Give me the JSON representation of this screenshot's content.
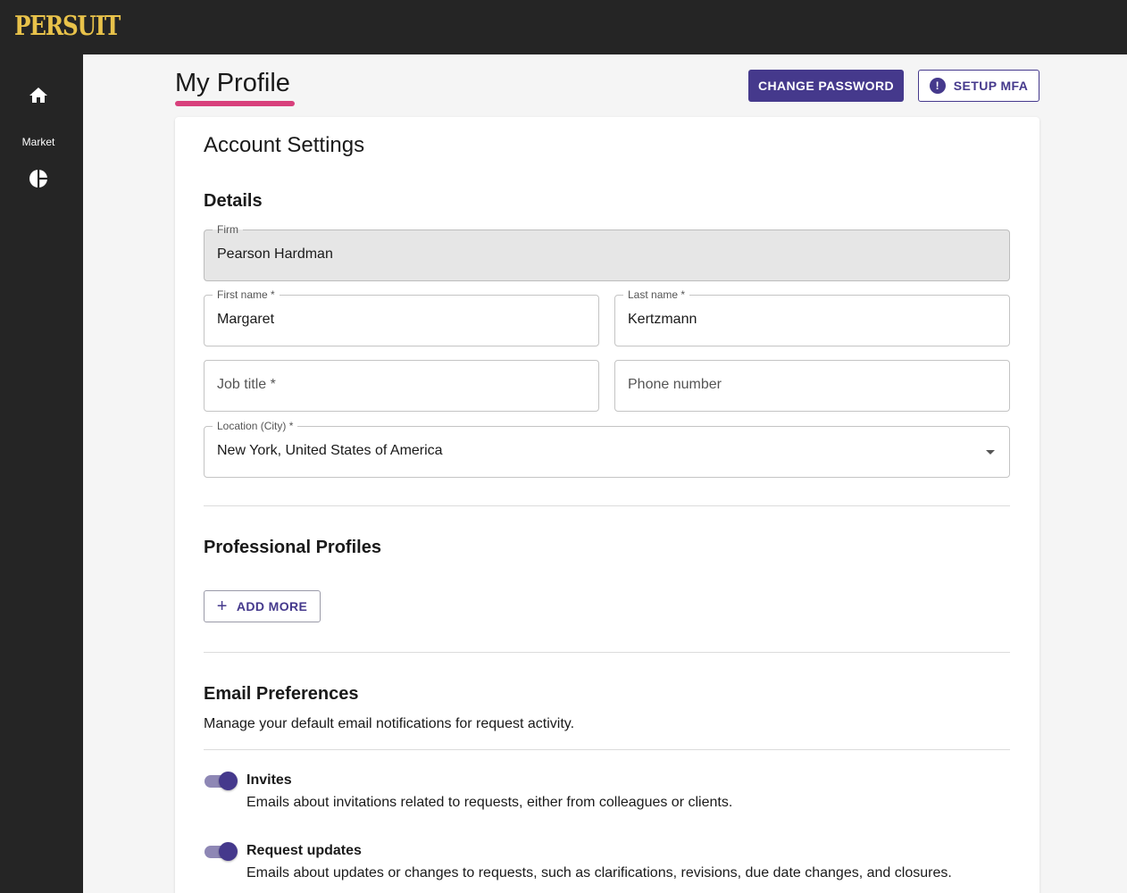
{
  "app": {
    "logo_text": "PERSUIT",
    "logo_color": "#e8c24a"
  },
  "sidebar": {
    "items": [
      {
        "icon": "home-icon",
        "label": ""
      },
      {
        "icon": "pie-chart-icon",
        "label": "Market"
      }
    ]
  },
  "header": {
    "title": "My Profile",
    "change_password_label": "CHANGE PASSWORD",
    "setup_mfa_label": "SETUP MFA",
    "setup_mfa_icon": "!"
  },
  "account": {
    "heading": "Account Settings",
    "details_heading": "Details",
    "fields": {
      "firm": {
        "label": "Firm",
        "value": "Pearson Hardman",
        "disabled": true
      },
      "first_name": {
        "label": "First name *",
        "value": "Margaret"
      },
      "last_name": {
        "label": "Last name *",
        "value": "Kertzmann"
      },
      "job_title": {
        "placeholder": "Job title *",
        "value": ""
      },
      "phone": {
        "placeholder": "Phone number",
        "value": ""
      },
      "location": {
        "label": "Location (City) *",
        "value": "New York, United States of America"
      }
    }
  },
  "professional_profiles": {
    "heading": "Professional Profiles",
    "add_more_label": "ADD MORE",
    "add_more_icon": "+"
  },
  "email_preferences": {
    "heading": "Email Preferences",
    "description": "Manage your default email notifications for request activity.",
    "items": [
      {
        "title": "Invites",
        "description": "Emails about invitations related to requests, either from colleagues or clients.",
        "enabled": true
      },
      {
        "title": "Request updates",
        "description": "Emails about updates or changes to requests, such as clarifications, revisions, due date changes, and closures.",
        "enabled": true
      }
    ]
  },
  "colors": {
    "primary": "#45398c",
    "accent": "#d8407c",
    "dark": "#252525"
  }
}
